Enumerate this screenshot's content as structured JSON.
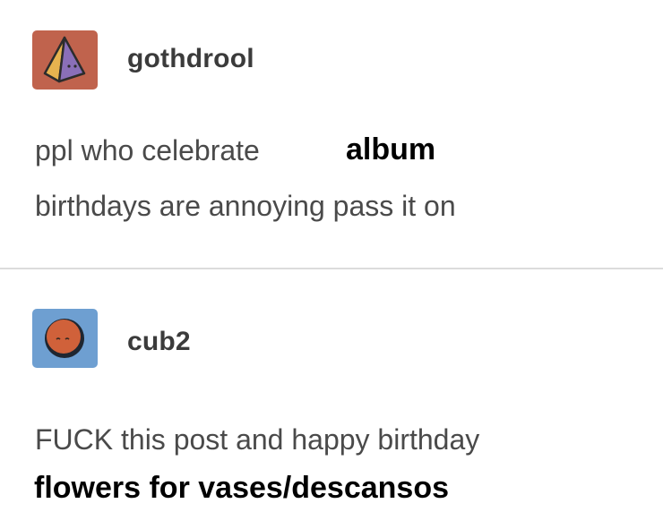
{
  "posts": [
    {
      "username": "gothdrool",
      "avatar_icon": "pyramid-icon",
      "avatar_bg": "#c0634d",
      "text_lines": [
        "ppl who celebrate",
        "birthdays are annoying pass it on"
      ],
      "overlay_text": "album"
    },
    {
      "username": "cub2",
      "avatar_icon": "moon-face-icon",
      "avatar_bg": "#6e9fd1",
      "text_lines": [
        "FUCK this post and happy birthday"
      ],
      "overlay_text": "flowers for vases/descansos"
    }
  ],
  "colors": {
    "text": "#4a4a4a",
    "divider": "#dcdcdc",
    "overlay_text": "#000000"
  }
}
